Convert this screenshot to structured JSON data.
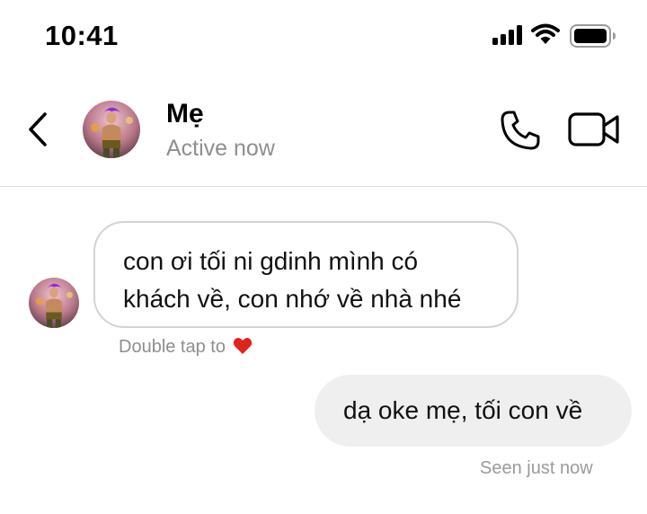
{
  "status_bar": {
    "time": "10:41"
  },
  "header": {
    "contact_name": "Mẹ",
    "contact_status": "Active now",
    "icons": [
      "back-arrow-icon",
      "phone-icon",
      "video-camera-icon"
    ]
  },
  "messages": {
    "incoming": {
      "line1": "con ơi tối ni gdinh mình có",
      "line2": "khách về, con nhớ về nhà nhé",
      "hint": "Double tap to"
    },
    "outgoing": {
      "text": "dạ oke mẹ, tối con về",
      "receipt": "Seen just now"
    }
  },
  "colors": {
    "secondary_text": "#8e8e8e",
    "bubble_border": "#d3d3d3",
    "outgoing_bubble": "#efefef",
    "heart": "#e0231c"
  }
}
